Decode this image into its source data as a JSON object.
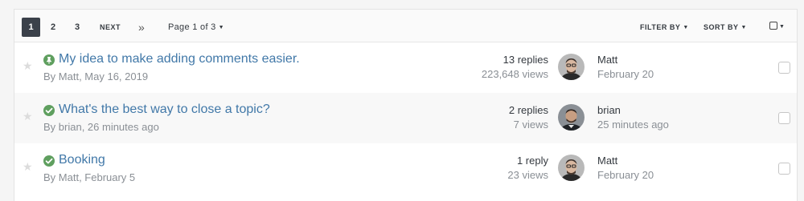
{
  "pagination": {
    "current": "1",
    "pages": [
      "2",
      "3"
    ],
    "next_label": "NEXT",
    "last_icon": "double-chevron-right-icon",
    "page_info": "Page 1 of 3"
  },
  "controls": {
    "filter_label": "FILTER BY",
    "sort_label": "SORT BY",
    "select_all_icon": "checkbox-dropdown-icon"
  },
  "topics": [
    {
      "title": "My idea to make adding comments easier.",
      "meta": "By Matt, May 16, 2019",
      "status_icon": "pin-icon",
      "replies": "13 replies",
      "views": "223,648 views",
      "last_user": "Matt",
      "last_time": "February 20"
    },
    {
      "title": "What's the best way to close a topic?",
      "meta": "By brian, 26 minutes ago",
      "status_icon": "solved-check-icon",
      "replies": "2 replies",
      "views": "7 views",
      "last_user": "brian",
      "last_time": "25 minutes ago"
    },
    {
      "title": "Booking",
      "meta": "By Matt, February 5",
      "status_icon": "solved-check-icon",
      "replies": "1 reply",
      "views": "23 views",
      "last_user": "Matt",
      "last_time": "February 20"
    }
  ],
  "colors": {
    "accent": "#4178a8",
    "active_page": "#3b414a",
    "status_green": "#5f9f5f"
  }
}
